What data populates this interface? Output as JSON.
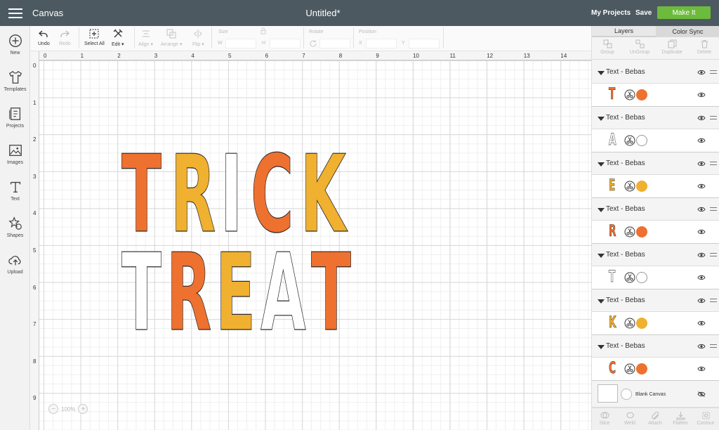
{
  "header": {
    "app_name": "Canvas",
    "doc_title": "Untitled*",
    "my_projects": "My Projects",
    "save": "Save",
    "make_it": "Make It"
  },
  "sidebar": {
    "items": [
      {
        "label": "New",
        "icon": "plus-circle-icon"
      },
      {
        "label": "Templates",
        "icon": "tshirt-icon"
      },
      {
        "label": "Projects",
        "icon": "projects-icon"
      },
      {
        "label": "Images",
        "icon": "image-icon"
      },
      {
        "label": "Text",
        "icon": "text-icon"
      },
      {
        "label": "Shapes",
        "icon": "shapes-icon"
      },
      {
        "label": "Upload",
        "icon": "upload-cloud-icon"
      }
    ]
  },
  "toolbar": {
    "undo": "Undo",
    "redo": "Redo",
    "select_all": "Select All",
    "edit": "Edit",
    "align": "Align",
    "arrange": "Arrange",
    "flip": "Flip",
    "size": "Size",
    "w": "W",
    "h": "H",
    "rotate": "Rotate",
    "position": "Position",
    "x": "X",
    "y": "Y"
  },
  "ruler": {
    "top": [
      "0",
      "1",
      "2",
      "3",
      "4",
      "5",
      "6",
      "7",
      "8",
      "9",
      "10",
      "11",
      "12",
      "13",
      "14"
    ],
    "left": [
      "0",
      "1",
      "2",
      "3",
      "4",
      "5",
      "6",
      "7",
      "8",
      "9"
    ]
  },
  "canvas": {
    "row1": [
      {
        "char": "T",
        "color": "#ee7130"
      },
      {
        "char": "R",
        "color": "#f0b030"
      },
      {
        "char": "I",
        "color": "#ffffff"
      },
      {
        "char": "C",
        "color": "#ee7130"
      },
      {
        "char": "K",
        "color": "#f0b030"
      }
    ],
    "row2": [
      {
        "char": "T",
        "color": "#ffffff"
      },
      {
        "char": "R",
        "color": "#ee7130"
      },
      {
        "char": "E",
        "color": "#f0b030"
      },
      {
        "char": "A",
        "color": "#ffffff"
      },
      {
        "char": "T",
        "color": "#ee7130"
      }
    ],
    "zoom": "100%",
    "zoom_minus": "−",
    "zoom_plus": "+"
  },
  "panel": {
    "tabs": [
      "Layers",
      "Color Sync"
    ],
    "tools": [
      "Group",
      "UnGroup",
      "Duplicate",
      "Delete"
    ],
    "layers": [
      {
        "name": "Text - Bebas",
        "glyph": "T",
        "color": "#ee7130"
      },
      {
        "name": "Text - Bebas",
        "glyph": "A",
        "color": "#ffffff"
      },
      {
        "name": "Text - Bebas",
        "glyph": "E",
        "color": "#f0b030"
      },
      {
        "name": "Text - Bebas",
        "glyph": "R",
        "color": "#ee7130"
      },
      {
        "name": "Text - Bebas",
        "glyph": "T",
        "color": "#ffffff"
      },
      {
        "name": "Text - Bebas",
        "glyph": "K",
        "color": "#f0b030"
      },
      {
        "name": "Text - Bebas",
        "glyph": "C",
        "color": "#ee7130"
      }
    ],
    "blank_canvas": "Blank Canvas",
    "bottom": [
      "Slice",
      "Weld",
      "Attach",
      "Flatten",
      "Contour"
    ]
  },
  "colors": {
    "header_bg": "#4d5961",
    "make_it": "#6cbb3c",
    "orange": "#ee7130",
    "yellow": "#f0b030"
  }
}
